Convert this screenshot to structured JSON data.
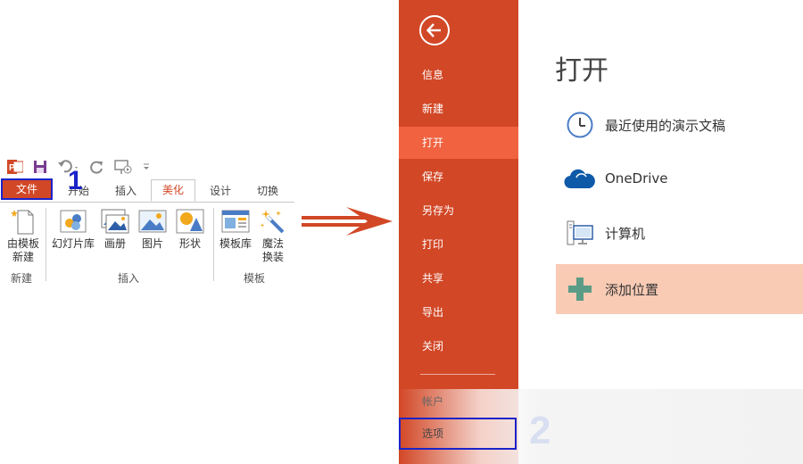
{
  "ribbon": {
    "tabs": {
      "file": "文件",
      "home": "开始",
      "insert": "插入",
      "beautify": "美化",
      "design": "设计",
      "transitions": "切换"
    },
    "step_number": "1",
    "buttons": {
      "new_from_template_line1": "由模板",
      "new_from_template_line2": "新建",
      "slide_library": "幻灯片库",
      "album": "画册",
      "picture": "图片",
      "shape": "形状",
      "template_library": "模板库",
      "magic_line1": "魔法",
      "magic_line2": "换装"
    },
    "groups": {
      "new": "新建",
      "insert": "插入",
      "template": "模板"
    }
  },
  "backstage": {
    "nav": [
      {
        "label": "信息"
      },
      {
        "label": "新建"
      },
      {
        "label": "打开"
      },
      {
        "label": "保存"
      },
      {
        "label": "另存为"
      },
      {
        "label": "打印"
      },
      {
        "label": "共享"
      },
      {
        "label": "导出"
      },
      {
        "label": "关闭"
      }
    ],
    "account": "帐户",
    "options": "选项",
    "step_number": "2"
  },
  "content": {
    "title": "打开",
    "locations": [
      {
        "label": "最近使用的演示文稿",
        "icon": "clock-icon"
      },
      {
        "label": "OneDrive",
        "icon": "cloud-icon"
      },
      {
        "label": "计算机",
        "icon": "computer-icon"
      },
      {
        "label": "添加位置",
        "icon": "plus-icon"
      }
    ]
  },
  "colors": {
    "accent": "#d24726",
    "active_nav": "#f06240",
    "highlight": "#f9cbb4",
    "annotation": "#1b23c9"
  }
}
